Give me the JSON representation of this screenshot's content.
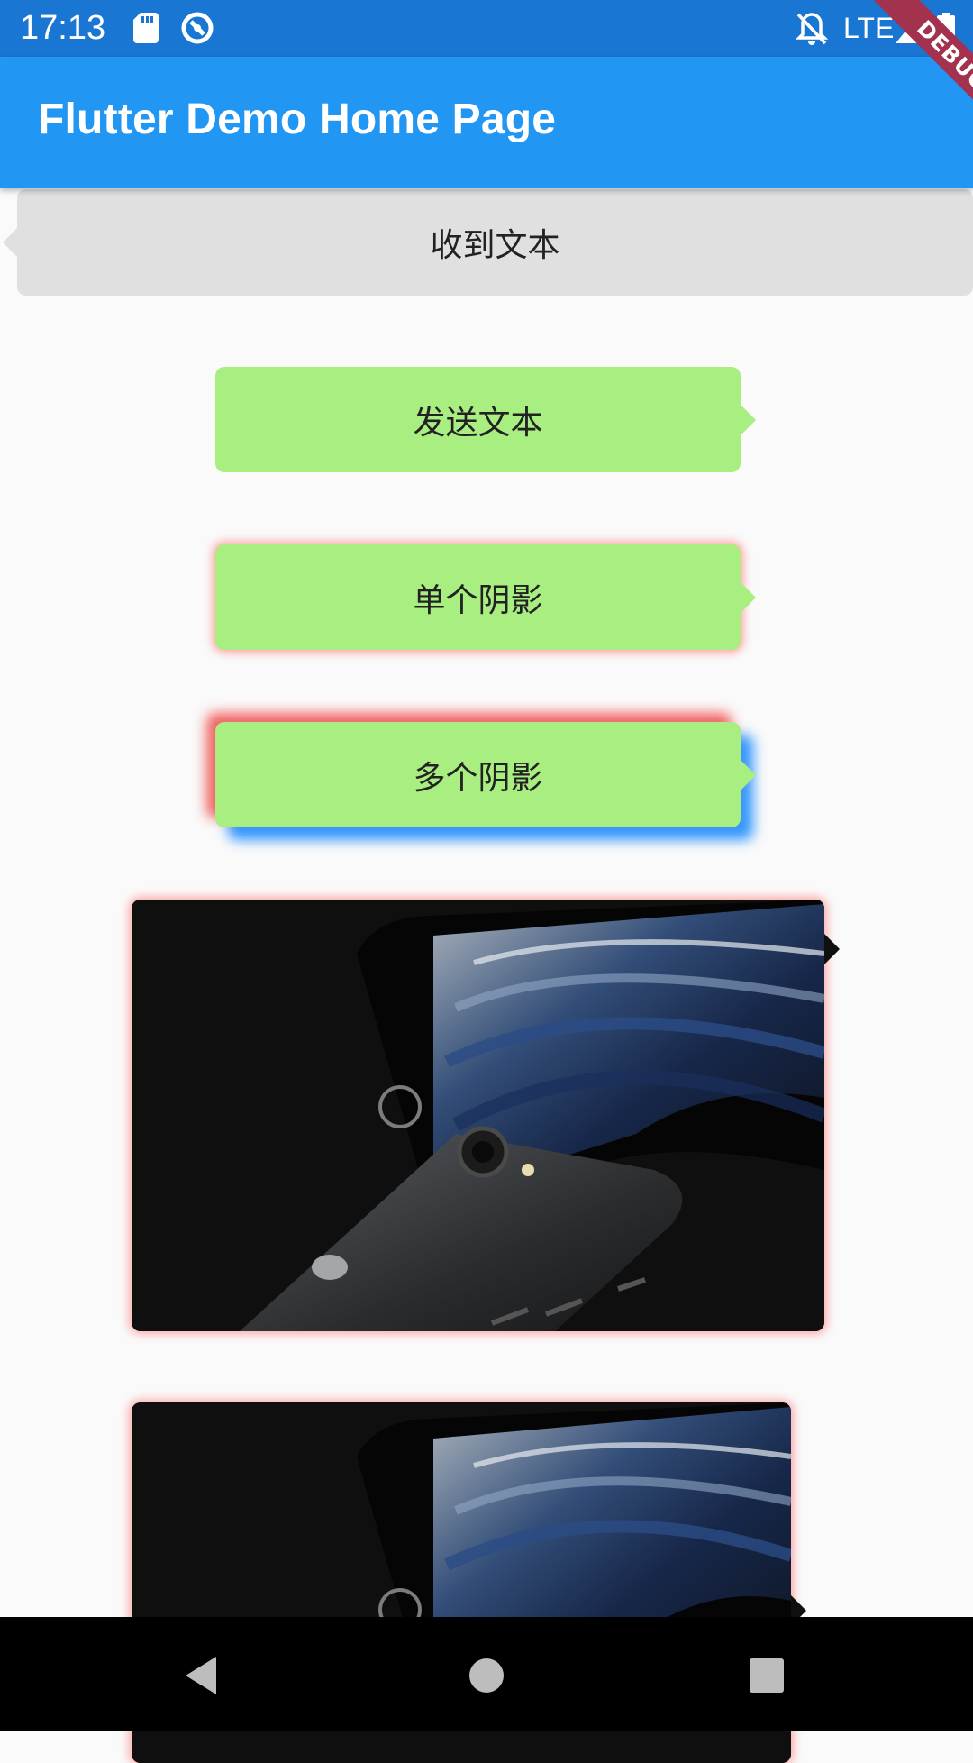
{
  "status_bar": {
    "time": "17:13",
    "network": "LTE",
    "icons": [
      "sd-card-icon",
      "sync-circle-icon",
      "bell-off-icon",
      "signal-icon",
      "battery-icon"
    ]
  },
  "app_bar": {
    "title": "Flutter Demo Home Page",
    "debug_label": "DEBUG",
    "color": "#2196f3"
  },
  "messages": {
    "received": "收到文本",
    "send": "发送文本",
    "single_shadow": "单个阴影",
    "multi_shadow": "多个阴影"
  },
  "images": [
    {
      "subject": "phone-photo"
    },
    {
      "subject": "phone-photo"
    }
  ],
  "colors": {
    "received_bubble": "#e0e0e0",
    "sent_bubble": "#a8ee80",
    "shadow_red": "#f04646",
    "shadow_blue": "#1e8cff"
  },
  "nav_bar": {
    "buttons": [
      "back-icon",
      "home-icon",
      "recents-icon"
    ]
  }
}
